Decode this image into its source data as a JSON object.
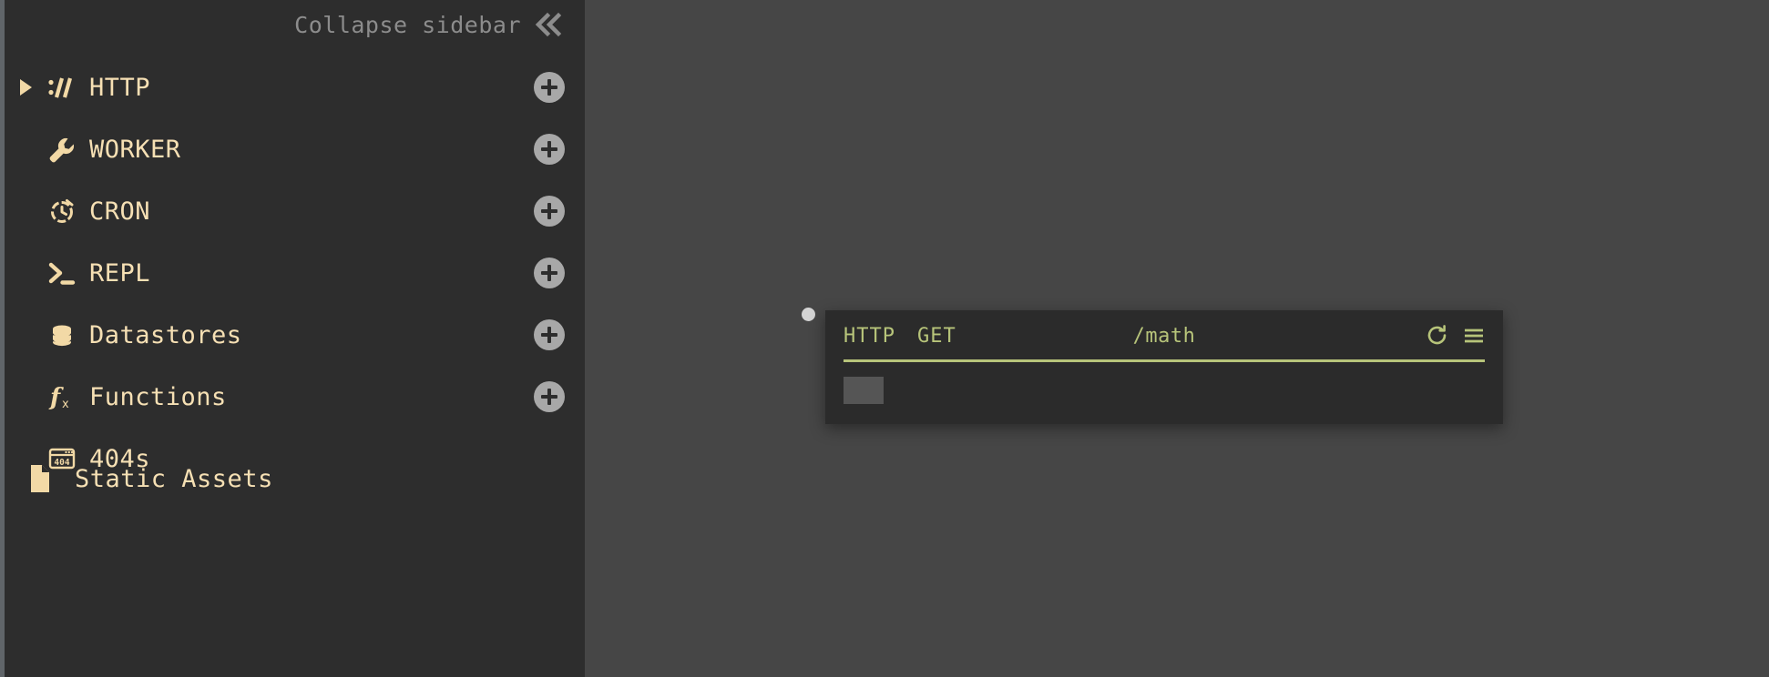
{
  "theme": {
    "sidebar_bg": "#2d2d2d",
    "canvas_bg": "#464646",
    "accent_cream": "#f6e0b4",
    "accent_green": "#b7c47a",
    "muted_gray": "#8c8c8c",
    "card_bg": "#2b2b2b"
  },
  "sidebar": {
    "collapse": {
      "label": "Collapse sidebar",
      "icon": "chevron-double-left-icon"
    },
    "items": [
      {
        "label": "HTTP",
        "icon": "protocol-slashes-icon",
        "has_caret": true,
        "caret_state": "collapsed",
        "has_add": true,
        "add_label": "+"
      },
      {
        "label": "WORKER",
        "icon": "wrench-icon",
        "has_caret": false,
        "caret_state": "",
        "has_add": true,
        "add_label": "+"
      },
      {
        "label": "CRON",
        "icon": "clock-icon",
        "has_caret": false,
        "caret_state": "",
        "has_add": true,
        "add_label": "+"
      },
      {
        "label": "REPL",
        "icon": "terminal-prompt-icon",
        "has_caret": false,
        "caret_state": "",
        "has_add": true,
        "add_label": "+"
      },
      {
        "label": "Datastores",
        "icon": "database-icon",
        "has_caret": false,
        "caret_state": "",
        "has_add": true,
        "add_label": "+"
      },
      {
        "label": "Functions",
        "icon": "function-fx-icon",
        "has_caret": false,
        "caret_state": "",
        "has_add": true,
        "add_label": "+"
      },
      {
        "label": "404s",
        "icon": "browser-404-icon",
        "has_caret": false,
        "caret_state": "",
        "has_add": false,
        "add_label": ""
      }
    ],
    "static_assets": {
      "label": "Static Assets",
      "icon": "file-document-icon"
    }
  },
  "canvas": {
    "node": {
      "handle_icon": "connection-dot-icon",
      "header": {
        "protocol": "HTTP",
        "method": "GET",
        "path": "/math",
        "refresh_icon": "refresh-icon",
        "menu_icon": "hamburger-menu-icon"
      },
      "body": {
        "placeholder": ""
      }
    }
  }
}
